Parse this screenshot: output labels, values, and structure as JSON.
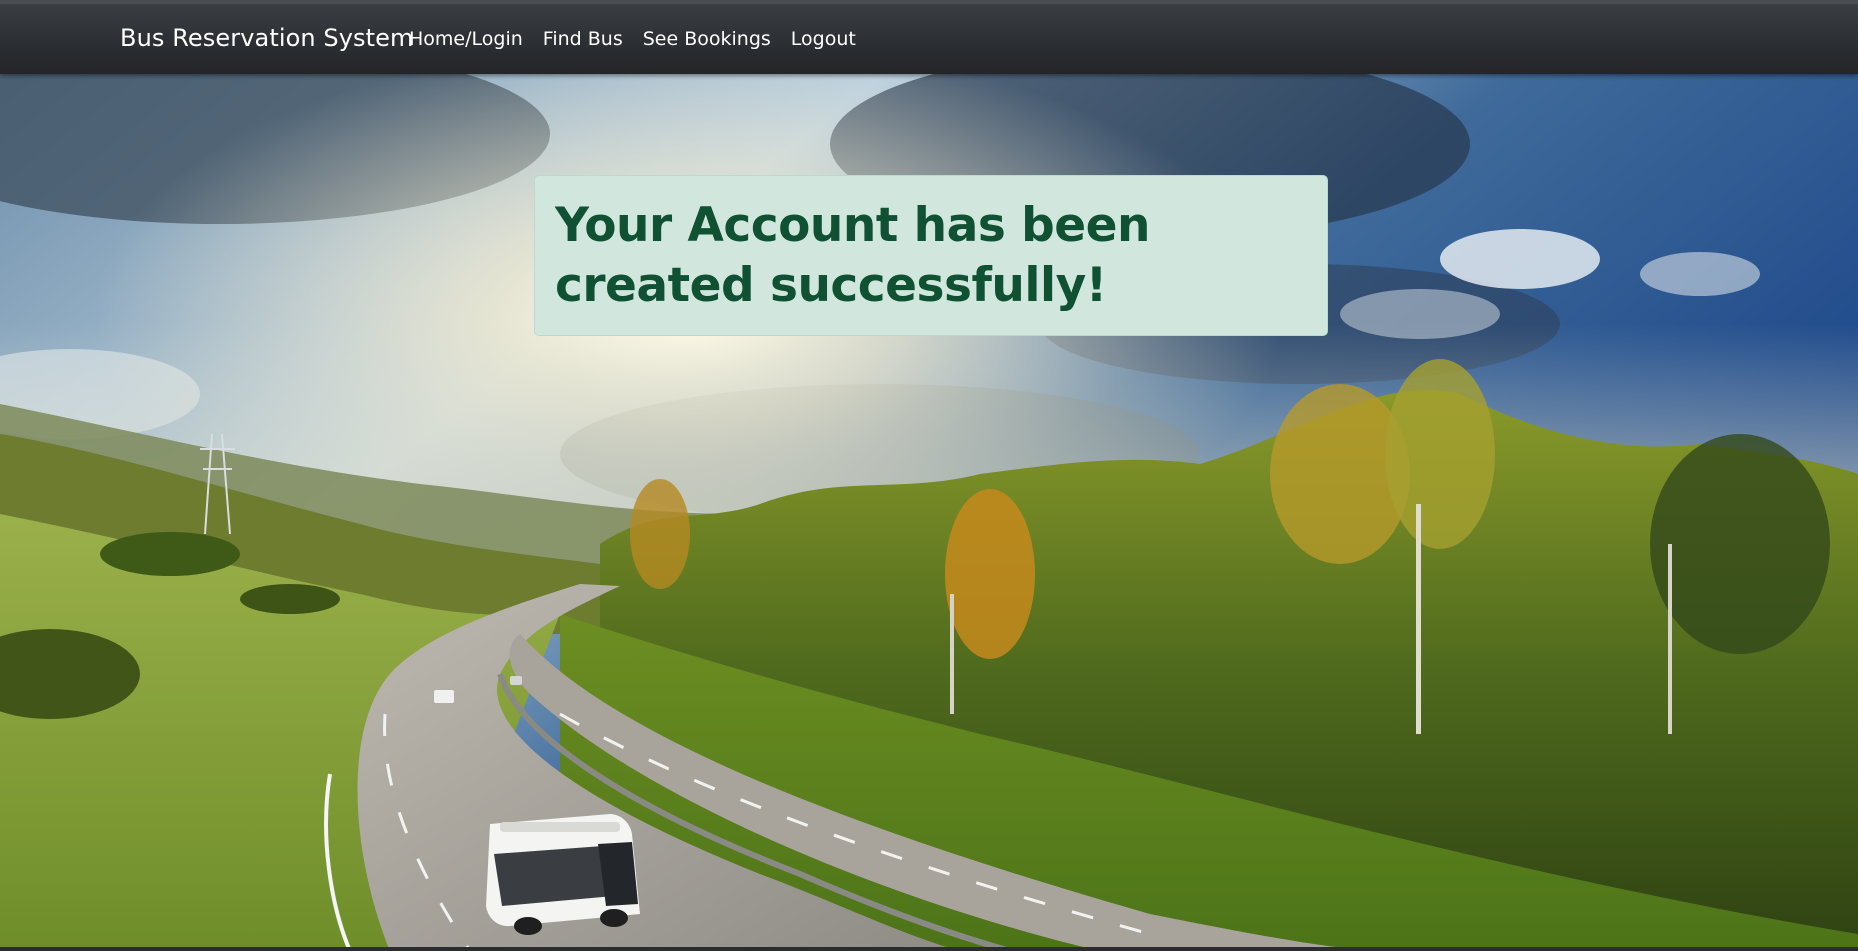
{
  "navbar": {
    "brand": "Bus Reservation System",
    "links": [
      {
        "label": "Home/Login"
      },
      {
        "label": "Find Bus"
      },
      {
        "label": "See Bookings"
      },
      {
        "label": "Logout"
      }
    ]
  },
  "alert": {
    "message": "Your Account has been created successfully!",
    "background_color": "#d1e7dd",
    "text_color": "#0f5132"
  },
  "hero": {
    "image": "highway-landscape-with-bus"
  }
}
